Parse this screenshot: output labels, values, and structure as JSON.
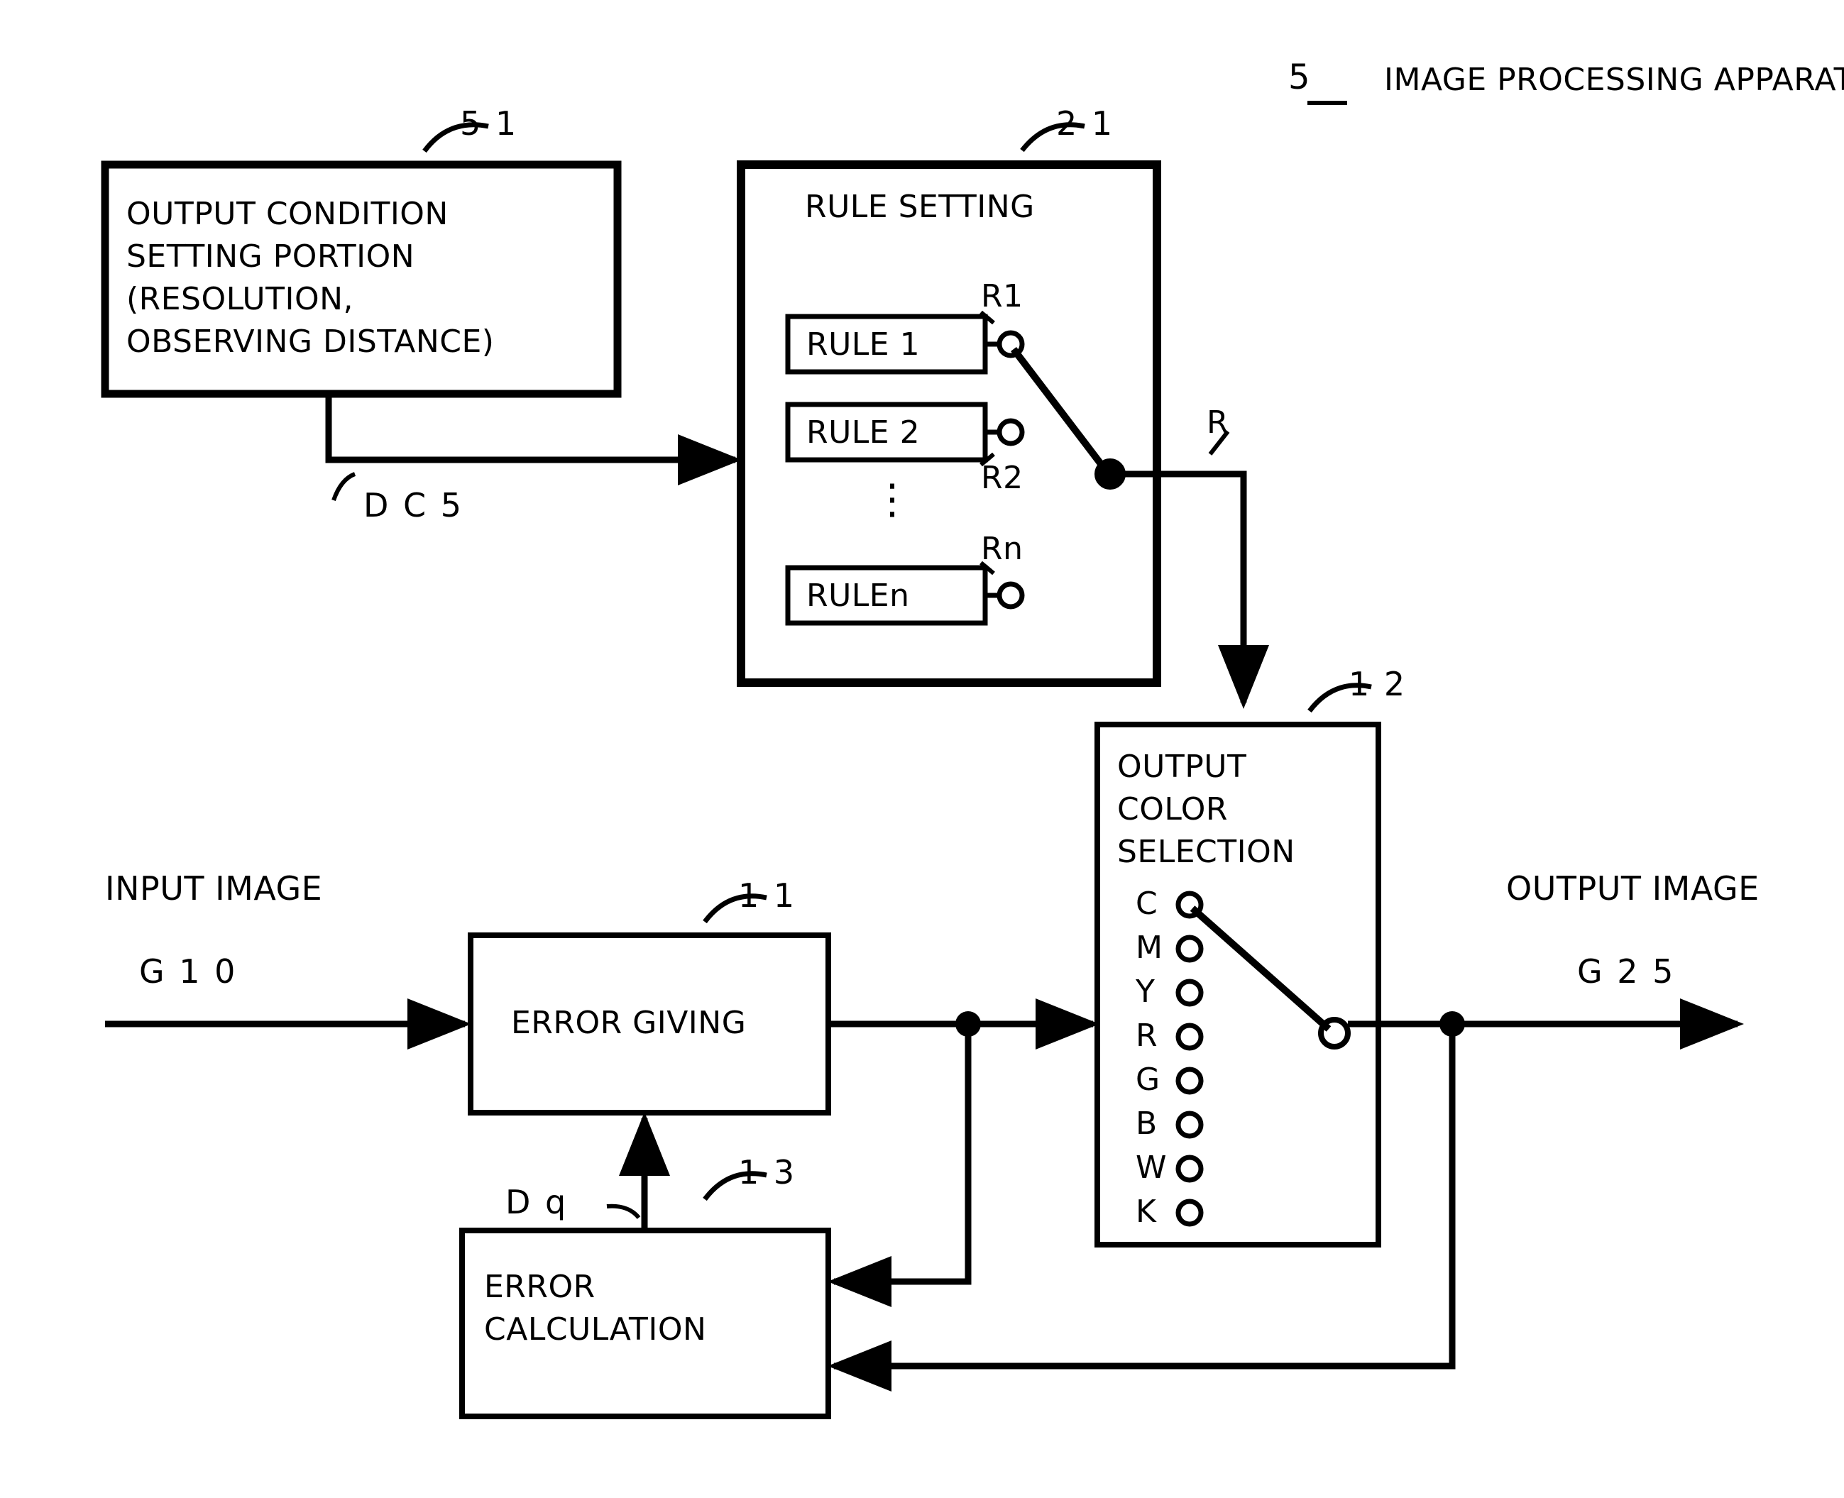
{
  "diagram": {
    "title": "IMAGE PROCESSING APPARATUS",
    "title_ref": "5",
    "blocks": {
      "output_condition": {
        "ref": "5 1",
        "line1": "OUTPUT CONDITION",
        "line2": "SETTING PORTION",
        "line3": "(RESOLUTION,",
        "line4": "OBSERVING DISTANCE)"
      },
      "rule_setting": {
        "ref": "2 1",
        "label": "RULE SETTING",
        "rules": [
          {
            "label": "RULE 1",
            "terminal": "R1"
          },
          {
            "label": "RULE 2",
            "terminal": "R2"
          },
          {
            "label": "RULEn",
            "terminal": "Rn"
          }
        ],
        "ellipsis": "⋮",
        "output_label": "R"
      },
      "output_color_selection": {
        "ref": "1 2",
        "line1": "OUTPUT",
        "line2": "COLOR",
        "line3": "SELECTION",
        "colors": [
          "C",
          "M",
          "Y",
          "R",
          "G",
          "B",
          "W",
          "K"
        ]
      },
      "error_giving": {
        "ref": "1 1",
        "label": "ERROR GIVING"
      },
      "error_calculation": {
        "ref": "1 3",
        "line1": "ERROR",
        "line2": "CALCULATION"
      }
    },
    "signals": {
      "dc5": "D C 5",
      "dq": "D q",
      "input_image_label": "INPUT IMAGE",
      "input_image_signal": "G 1 0",
      "output_image_label": "OUTPUT IMAGE",
      "output_image_signal": "G 2 5"
    },
    "colors": {
      "ink": "#000000",
      "paper": "#ffffff"
    }
  }
}
